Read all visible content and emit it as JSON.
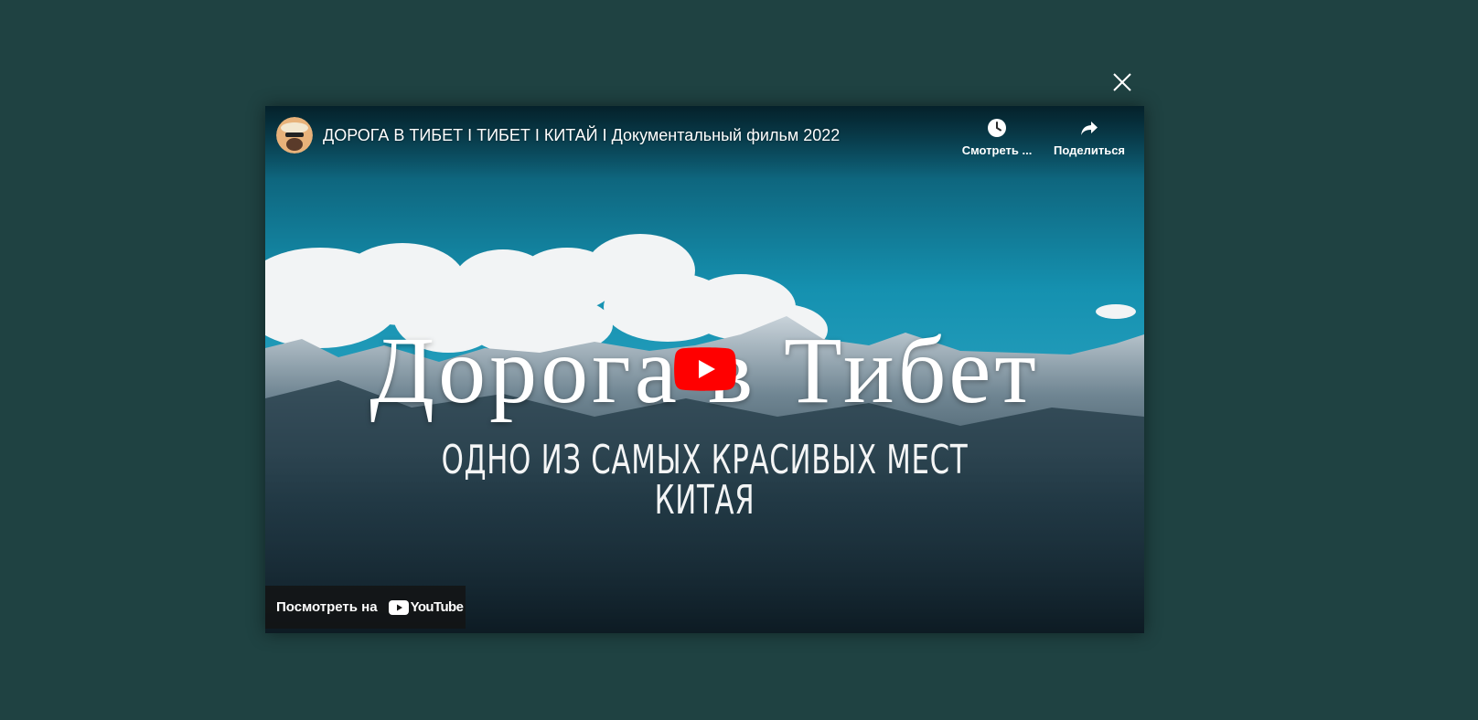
{
  "modal": {
    "close_icon": "close-icon"
  },
  "video": {
    "title": "ДОРОГА В ТИБЕТ І ТИБЕТ І КИТАЙ І Документальный фильм 2022",
    "channel_avatar": "avatar",
    "overlay_title": "Дорога в Тибет",
    "overlay_subtitle": "ОДНО ИЗ САМЫХ КРАСИВЫХ МЕСТ КИТАЯ"
  },
  "actions": {
    "watch_later_label": "Смотреть ...",
    "watch_later_icon": "clock-icon",
    "share_label": "Поделиться",
    "share_icon": "share-icon"
  },
  "player": {
    "play_icon": "youtube-play-icon",
    "watch_on_label": "Посмотреть на",
    "youtube_wordmark": "YouTube"
  },
  "colors": {
    "page_background": "#1f4242",
    "play_button": "#ff0000",
    "sky": "#1689a8"
  }
}
